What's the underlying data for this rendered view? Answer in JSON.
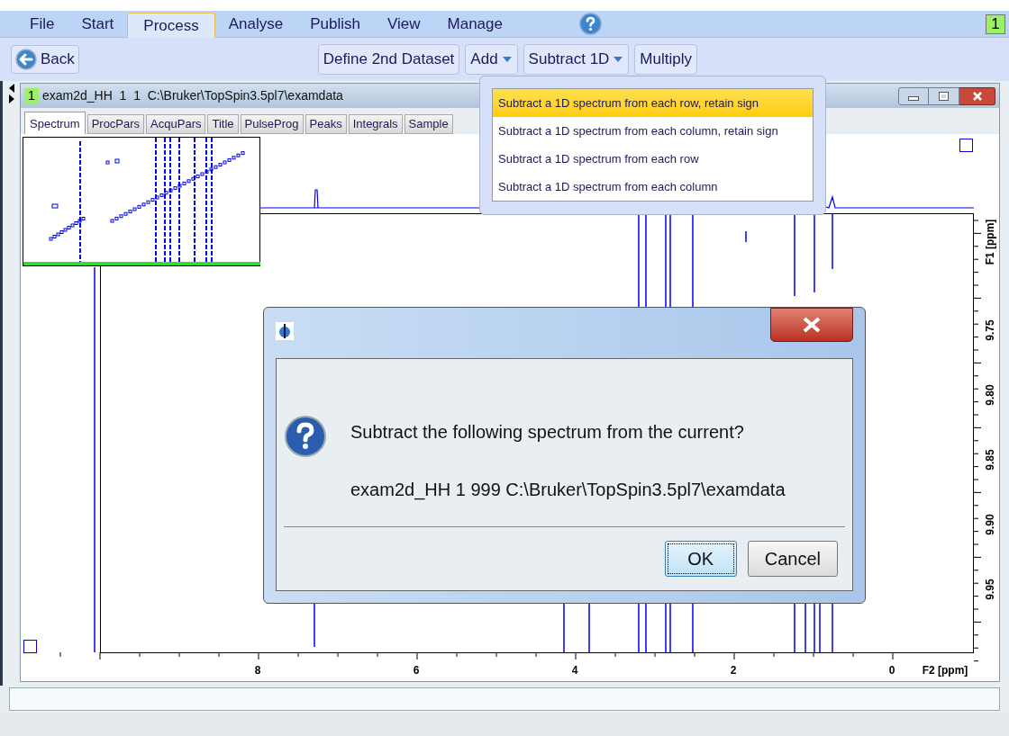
{
  "menu": [
    {
      "label": "File",
      "selected": false
    },
    {
      "label": "Start",
      "selected": false
    },
    {
      "label": "Process",
      "selected": true
    },
    {
      "label": "Analyse",
      "selected": false
    },
    {
      "label": "Publish",
      "selected": false
    },
    {
      "label": "View",
      "selected": false
    },
    {
      "label": "Manage",
      "selected": false
    }
  ],
  "window_badge": "1",
  "toolbar": {
    "back": {
      "label": "Back"
    },
    "buttons": [
      {
        "label": "Define 2nd Dataset",
        "dropdown": false
      },
      {
        "label": "Add",
        "dropdown": true
      },
      {
        "label": "Subtract 1D",
        "dropdown": true
      },
      {
        "label": "Multiply",
        "dropdown": false
      }
    ]
  },
  "dropdown_menu": {
    "items": [
      {
        "label": "Subtract a 1D spectrum from each row, retain sign",
        "selected": true
      },
      {
        "label": "Subtract a 1D spectrum from each column, retain sign",
        "selected": false
      },
      {
        "label": "Subtract a 1D spectrum from each row",
        "selected": false
      },
      {
        "label": "Subtract a 1D spectrum from each column",
        "selected": false
      }
    ]
  },
  "data_window": {
    "number": "1",
    "title": "exam2d_HH  1  1  C:\\Bruker\\TopSpin3.5pl7\\examdata",
    "tabs": [
      {
        "label": "Spectrum",
        "selected": true
      },
      {
        "label": "ProcPars",
        "selected": false
      },
      {
        "label": "AcquPars",
        "selected": false
      },
      {
        "label": "Title",
        "selected": false
      },
      {
        "label": "PulseProg",
        "selected": false
      },
      {
        "label": "Peaks",
        "selected": false
      },
      {
        "label": "Integrals",
        "selected": false
      },
      {
        "label": "Sample",
        "selected": false
      }
    ],
    "plot": {
      "x_axis": {
        "label": "F2 [ppm]",
        "ticks": [
          "8",
          "6",
          "4",
          "2",
          "0"
        ]
      },
      "y_axis": {
        "label": "F1 [ppm]",
        "ticks": [
          "9.75",
          "9.80",
          "9.85",
          "9.90",
          "9.95"
        ]
      }
    }
  },
  "dialog": {
    "message": "Subtract the following spectrum from the current?",
    "detail": "exam2d_HH 1 999 C:\\Bruker\\TopSpin3.5pl7\\examdata",
    "buttons": [
      {
        "label": "OK",
        "focused": true
      },
      {
        "label": "Cancel",
        "focused": false
      }
    ]
  }
}
